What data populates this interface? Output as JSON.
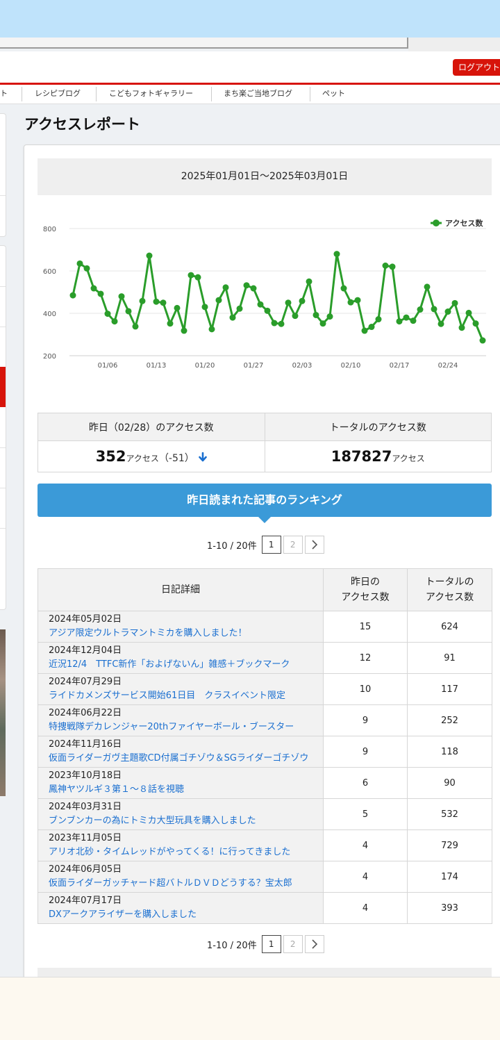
{
  "header": {
    "logout_label": "ログアウト"
  },
  "nav": {
    "items": [
      "ト",
      "レシピブログ",
      "こどもフォトギャラリー",
      "まち楽ご当地ブログ",
      "ペット"
    ]
  },
  "page": {
    "title": "アクセスレポート"
  },
  "report": {
    "date_range": "2025年01月01日〜2025年03月01日"
  },
  "colors": {
    "accent_blue": "#3b9ad8",
    "series_green": "#2a9d2a",
    "logout_red": "#d7140a",
    "link_blue": "#1a6fd0"
  },
  "chart_data": {
    "type": "line",
    "series": [
      {
        "name": "アクセス数",
        "values": [
          485,
          635,
          612,
          518,
          492,
          398,
          362,
          480,
          410,
          338,
          458,
          672,
          455,
          450,
          352,
          425,
          318,
          580,
          570,
          430,
          325,
          462,
          522,
          380,
          422,
          532,
          518,
          442,
          412,
          354,
          350,
          450,
          388,
          458,
          550,
          392,
          352,
          385,
          680,
          518,
          452,
          462,
          318,
          336,
          372,
          625,
          620,
          362,
          380,
          365,
          418,
          525,
          420,
          350,
          408,
          448,
          332,
          402,
          352,
          272
        ]
      }
    ],
    "x_start": "2025-01-01",
    "x_ticks": [
      "01/06",
      "01/13",
      "01/20",
      "01/27",
      "02/03",
      "02/10",
      "02/17",
      "02/24"
    ],
    "y_ticks": [
      200,
      400,
      600,
      800
    ],
    "ylim": [
      200,
      800
    ],
    "grid": true,
    "legend": "top-right"
  },
  "stats": {
    "yesterday_label": "昨日（02/28）のアクセス数",
    "total_label": "トータルのアクセス数",
    "yesterday_value": "352",
    "yesterday_unit": "アクセス",
    "yesterday_diff": "（-51）",
    "total_value": "187827",
    "total_unit": "アクセス"
  },
  "ranking": {
    "title": "昨日読まれた記事のランキング",
    "pager_count": "1-10 / 20件",
    "pages": [
      "1",
      "2"
    ],
    "columns": {
      "detail": "日記詳細",
      "yesterday": "昨日の\nアクセス数",
      "total": "トータルの\nアクセス数"
    },
    "rows": [
      {
        "date": "2024年05月02日",
        "title": "アジア限定ウルトラマントミカを購入しました！",
        "yesterday": "15",
        "total": "624"
      },
      {
        "date": "2024年12月04日",
        "title": "近況12/4　TTFC新作「およげないん」雑感＋ブックマーク",
        "yesterday": "12",
        "total": "91"
      },
      {
        "date": "2024年07月29日",
        "title": "ライドカメンズサービス開始61日目　クラスイベント限定",
        "yesterday": "10",
        "total": "117"
      },
      {
        "date": "2024年06月22日",
        "title": "特捜戦隊デカレンジャー20thファイヤーボール・ブースター",
        "yesterday": "9",
        "total": "252"
      },
      {
        "date": "2024年11月16日",
        "title": "仮面ライダーガヴ主題歌CD付属ゴチゾウ＆SGライダーゴチゾウ",
        "yesterday": "9",
        "total": "118"
      },
      {
        "date": "2023年10月18日",
        "title": "鳳神ヤツルギ３第１～８話を視聴",
        "yesterday": "6",
        "total": "90"
      },
      {
        "date": "2024年03月31日",
        "title": "ブンブンカーの為にトミカ大型玩具を購入しました",
        "yesterday": "5",
        "total": "532"
      },
      {
        "date": "2023年11月05日",
        "title": "アリオ北砂・タイムレッドがやってくる！に行ってきました",
        "yesterday": "4",
        "total": "729"
      },
      {
        "date": "2024年06月05日",
        "title": "仮面ライダーガッチャード超バトルＤＶＤどうする？宝太郎",
        "yesterday": "4",
        "total": "174"
      },
      {
        "date": "2024年07月17日",
        "title": "DXアークアライザーを購入しました",
        "yesterday": "4",
        "total": "393"
      }
    ]
  }
}
